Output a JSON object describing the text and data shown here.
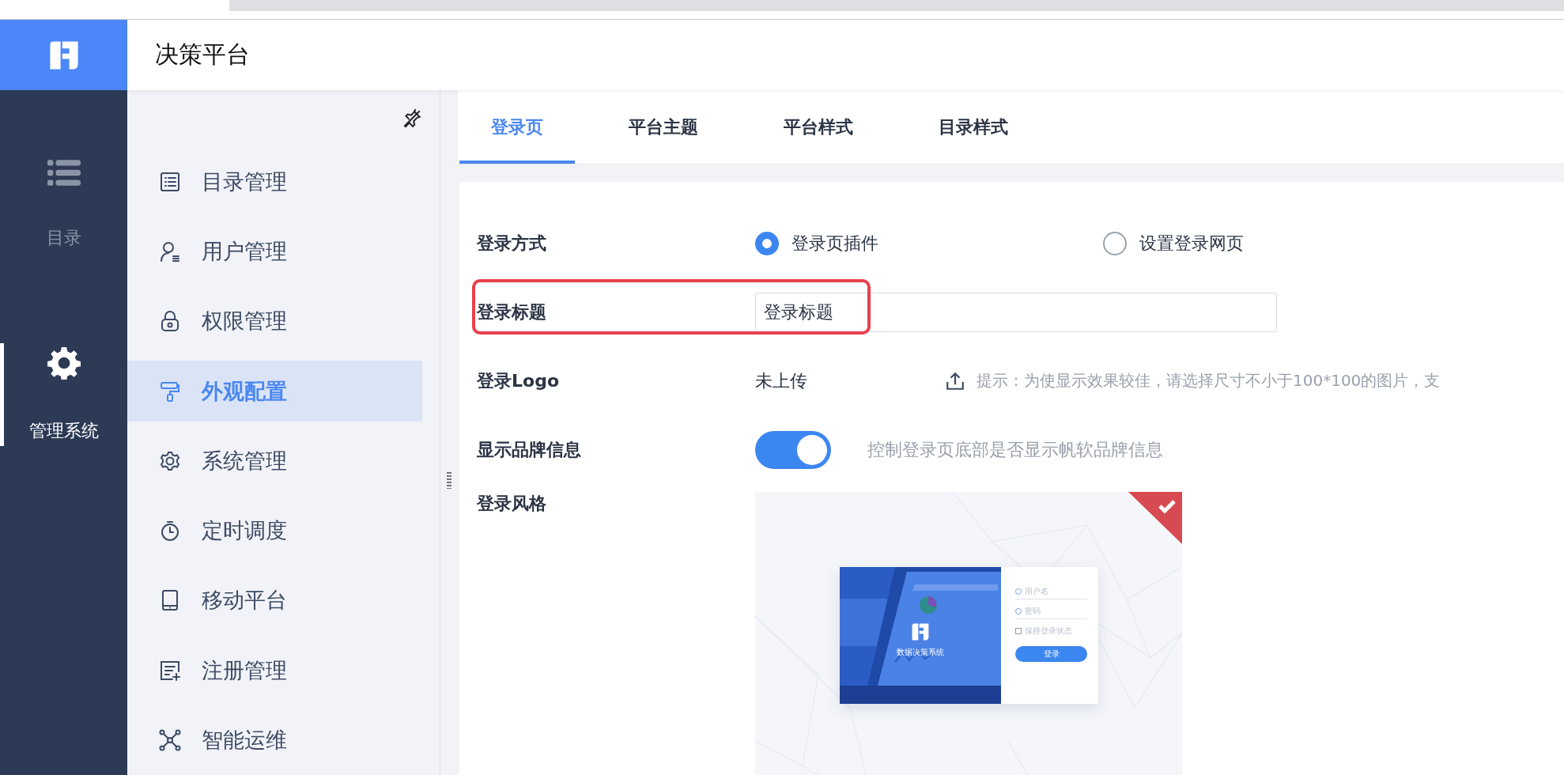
{
  "header": {
    "title": "决策平台"
  },
  "rail": [
    {
      "label": "目录",
      "selected": false
    },
    {
      "label": "管理系统",
      "selected": true
    }
  ],
  "menu": [
    {
      "label": "目录管理",
      "selected": false
    },
    {
      "label": "用户管理",
      "selected": false
    },
    {
      "label": "权限管理",
      "selected": false
    },
    {
      "label": "外观配置",
      "selected": true
    },
    {
      "label": "系统管理",
      "selected": false
    },
    {
      "label": "定时调度",
      "selected": false
    },
    {
      "label": "移动平台",
      "selected": false
    },
    {
      "label": "注册管理",
      "selected": false
    },
    {
      "label": "智能运维",
      "selected": false
    }
  ],
  "tabs": [
    {
      "label": "登录页",
      "selected": true
    },
    {
      "label": "平台主题",
      "selected": false
    },
    {
      "label": "平台样式",
      "selected": false
    },
    {
      "label": "目录样式",
      "selected": false
    }
  ],
  "form": [
    {
      "kind": "radio",
      "label": "登录方式",
      "options": [
        {
          "label": "登录页插件",
          "selected": true
        },
        {
          "label": "设置登录网页",
          "selected": false
        }
      ]
    },
    {
      "kind": "input",
      "label": "登录标题",
      "value": "登录标题",
      "highlighted": true
    },
    {
      "kind": "upload",
      "label": "登录Logo",
      "status": "未上传",
      "hint": "提示：为使显示效果较佳，请选择尺寸不小于100*100的图片，支"
    },
    {
      "kind": "toggle",
      "label": "显示品牌信息",
      "on": true,
      "note": "控制登录页底部是否显示帆软品牌信息"
    },
    {
      "kind": "style",
      "label": "登录风格",
      "styles": [
        {
          "selected": true,
          "title": "数据决策系统",
          "username": "用户名",
          "password": "密码",
          "remember": "保持登录状态",
          "remember_checked": false,
          "button": "登录"
        }
      ]
    }
  ]
}
